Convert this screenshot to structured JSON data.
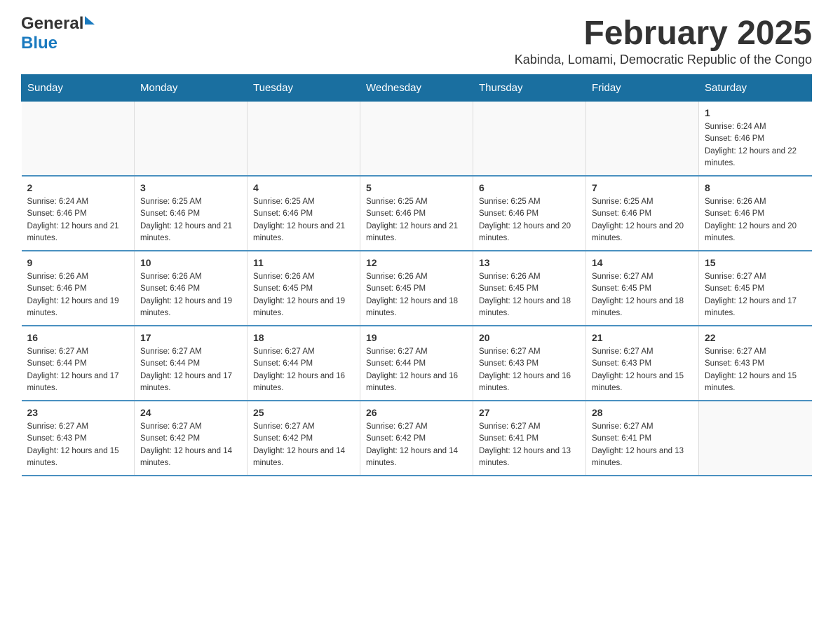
{
  "logo": {
    "text_general": "General",
    "text_blue": "Blue"
  },
  "title": "February 2025",
  "subtitle": "Kabinda, Lomami, Democratic Republic of the Congo",
  "weekdays": [
    "Sunday",
    "Monday",
    "Tuesday",
    "Wednesday",
    "Thursday",
    "Friday",
    "Saturday"
  ],
  "weeks": [
    [
      {
        "day": "",
        "sunrise": "",
        "sunset": "",
        "daylight": ""
      },
      {
        "day": "",
        "sunrise": "",
        "sunset": "",
        "daylight": ""
      },
      {
        "day": "",
        "sunrise": "",
        "sunset": "",
        "daylight": ""
      },
      {
        "day": "",
        "sunrise": "",
        "sunset": "",
        "daylight": ""
      },
      {
        "day": "",
        "sunrise": "",
        "sunset": "",
        "daylight": ""
      },
      {
        "day": "",
        "sunrise": "",
        "sunset": "",
        "daylight": ""
      },
      {
        "day": "1",
        "sunrise": "Sunrise: 6:24 AM",
        "sunset": "Sunset: 6:46 PM",
        "daylight": "Daylight: 12 hours and 22 minutes."
      }
    ],
    [
      {
        "day": "2",
        "sunrise": "Sunrise: 6:24 AM",
        "sunset": "Sunset: 6:46 PM",
        "daylight": "Daylight: 12 hours and 21 minutes."
      },
      {
        "day": "3",
        "sunrise": "Sunrise: 6:25 AM",
        "sunset": "Sunset: 6:46 PM",
        "daylight": "Daylight: 12 hours and 21 minutes."
      },
      {
        "day": "4",
        "sunrise": "Sunrise: 6:25 AM",
        "sunset": "Sunset: 6:46 PM",
        "daylight": "Daylight: 12 hours and 21 minutes."
      },
      {
        "day": "5",
        "sunrise": "Sunrise: 6:25 AM",
        "sunset": "Sunset: 6:46 PM",
        "daylight": "Daylight: 12 hours and 21 minutes."
      },
      {
        "day": "6",
        "sunrise": "Sunrise: 6:25 AM",
        "sunset": "Sunset: 6:46 PM",
        "daylight": "Daylight: 12 hours and 20 minutes."
      },
      {
        "day": "7",
        "sunrise": "Sunrise: 6:25 AM",
        "sunset": "Sunset: 6:46 PM",
        "daylight": "Daylight: 12 hours and 20 minutes."
      },
      {
        "day": "8",
        "sunrise": "Sunrise: 6:26 AM",
        "sunset": "Sunset: 6:46 PM",
        "daylight": "Daylight: 12 hours and 20 minutes."
      }
    ],
    [
      {
        "day": "9",
        "sunrise": "Sunrise: 6:26 AM",
        "sunset": "Sunset: 6:46 PM",
        "daylight": "Daylight: 12 hours and 19 minutes."
      },
      {
        "day": "10",
        "sunrise": "Sunrise: 6:26 AM",
        "sunset": "Sunset: 6:46 PM",
        "daylight": "Daylight: 12 hours and 19 minutes."
      },
      {
        "day": "11",
        "sunrise": "Sunrise: 6:26 AM",
        "sunset": "Sunset: 6:45 PM",
        "daylight": "Daylight: 12 hours and 19 minutes."
      },
      {
        "day": "12",
        "sunrise": "Sunrise: 6:26 AM",
        "sunset": "Sunset: 6:45 PM",
        "daylight": "Daylight: 12 hours and 18 minutes."
      },
      {
        "day": "13",
        "sunrise": "Sunrise: 6:26 AM",
        "sunset": "Sunset: 6:45 PM",
        "daylight": "Daylight: 12 hours and 18 minutes."
      },
      {
        "day": "14",
        "sunrise": "Sunrise: 6:27 AM",
        "sunset": "Sunset: 6:45 PM",
        "daylight": "Daylight: 12 hours and 18 minutes."
      },
      {
        "day": "15",
        "sunrise": "Sunrise: 6:27 AM",
        "sunset": "Sunset: 6:45 PM",
        "daylight": "Daylight: 12 hours and 17 minutes."
      }
    ],
    [
      {
        "day": "16",
        "sunrise": "Sunrise: 6:27 AM",
        "sunset": "Sunset: 6:44 PM",
        "daylight": "Daylight: 12 hours and 17 minutes."
      },
      {
        "day": "17",
        "sunrise": "Sunrise: 6:27 AM",
        "sunset": "Sunset: 6:44 PM",
        "daylight": "Daylight: 12 hours and 17 minutes."
      },
      {
        "day": "18",
        "sunrise": "Sunrise: 6:27 AM",
        "sunset": "Sunset: 6:44 PM",
        "daylight": "Daylight: 12 hours and 16 minutes."
      },
      {
        "day": "19",
        "sunrise": "Sunrise: 6:27 AM",
        "sunset": "Sunset: 6:44 PM",
        "daylight": "Daylight: 12 hours and 16 minutes."
      },
      {
        "day": "20",
        "sunrise": "Sunrise: 6:27 AM",
        "sunset": "Sunset: 6:43 PM",
        "daylight": "Daylight: 12 hours and 16 minutes."
      },
      {
        "day": "21",
        "sunrise": "Sunrise: 6:27 AM",
        "sunset": "Sunset: 6:43 PM",
        "daylight": "Daylight: 12 hours and 15 minutes."
      },
      {
        "day": "22",
        "sunrise": "Sunrise: 6:27 AM",
        "sunset": "Sunset: 6:43 PM",
        "daylight": "Daylight: 12 hours and 15 minutes."
      }
    ],
    [
      {
        "day": "23",
        "sunrise": "Sunrise: 6:27 AM",
        "sunset": "Sunset: 6:43 PM",
        "daylight": "Daylight: 12 hours and 15 minutes."
      },
      {
        "day": "24",
        "sunrise": "Sunrise: 6:27 AM",
        "sunset": "Sunset: 6:42 PM",
        "daylight": "Daylight: 12 hours and 14 minutes."
      },
      {
        "day": "25",
        "sunrise": "Sunrise: 6:27 AM",
        "sunset": "Sunset: 6:42 PM",
        "daylight": "Daylight: 12 hours and 14 minutes."
      },
      {
        "day": "26",
        "sunrise": "Sunrise: 6:27 AM",
        "sunset": "Sunset: 6:42 PM",
        "daylight": "Daylight: 12 hours and 14 minutes."
      },
      {
        "day": "27",
        "sunrise": "Sunrise: 6:27 AM",
        "sunset": "Sunset: 6:41 PM",
        "daylight": "Daylight: 12 hours and 13 minutes."
      },
      {
        "day": "28",
        "sunrise": "Sunrise: 6:27 AM",
        "sunset": "Sunset: 6:41 PM",
        "daylight": "Daylight: 12 hours and 13 minutes."
      },
      {
        "day": "",
        "sunrise": "",
        "sunset": "",
        "daylight": ""
      }
    ]
  ]
}
